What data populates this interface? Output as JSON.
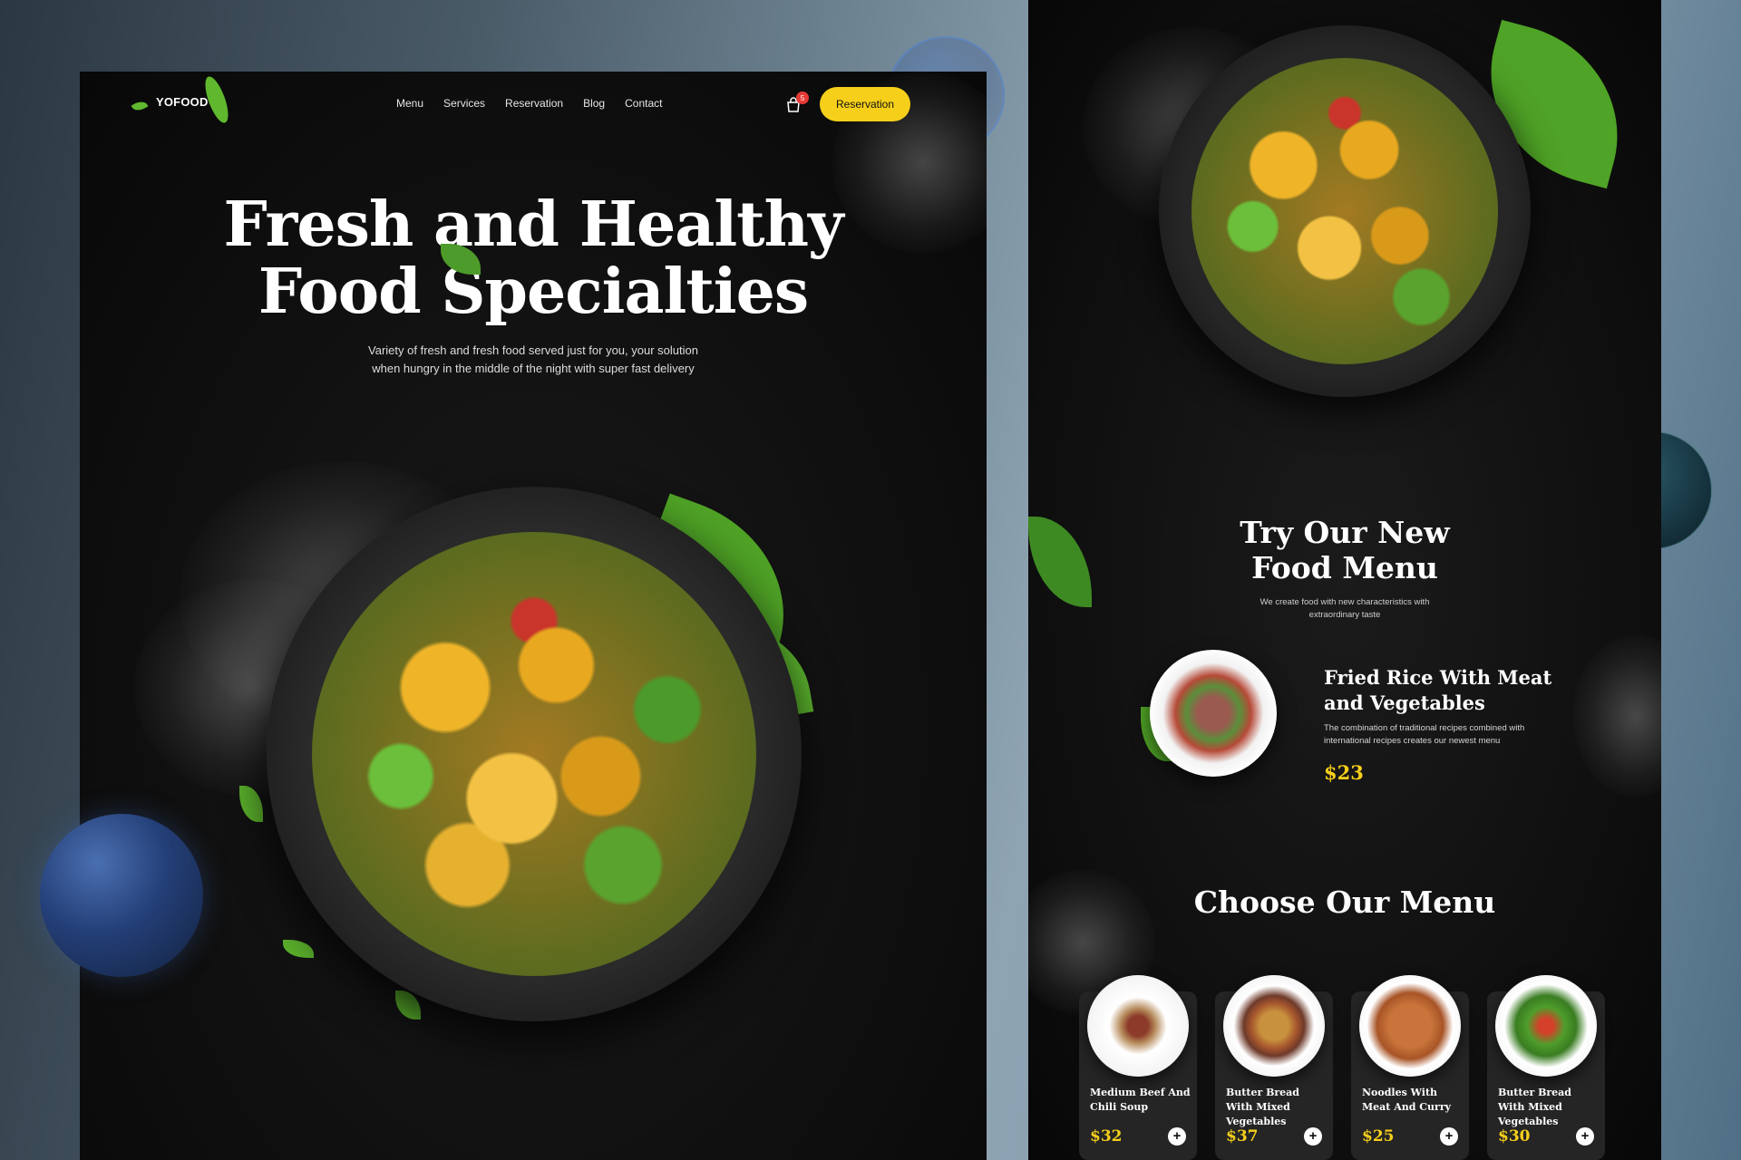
{
  "brand": {
    "logo_text": "YOFOOD"
  },
  "nav": {
    "items": [
      "Menu",
      "Services",
      "Reservation",
      "Blog",
      "Contact"
    ],
    "cart_count": "5",
    "reservation_label": "Reservation"
  },
  "hero": {
    "title_line1": "Fresh and Healthy",
    "title_line2": "Food Specialties",
    "subtitle": "Variety of fresh and fresh food served just for you, your solution when hungry in the middle of the night with super fast delivery"
  },
  "try_section": {
    "title_line1": "Try Our New",
    "title_line2": "Food Menu",
    "subtitle": "We create food with new characteristics with extraordinary taste",
    "featured": {
      "name": "Fried Rice With Meat and Vegetables",
      "description": "The combination of traditional recipes combined with international recipes creates our newest menu",
      "price": "$23"
    }
  },
  "choose_section": {
    "title": "Choose Our Menu",
    "items": [
      {
        "name": "Medium Beef And Chili Soup",
        "price": "$32"
      },
      {
        "name": "Butter Bread With Mixed Vegetables",
        "price": "$37"
      },
      {
        "name": "Noodles With Meat And Curry",
        "price": "$25"
      },
      {
        "name": "Butter Bread With Mixed Vegetables",
        "price": "$30"
      }
    ]
  },
  "colors": {
    "accent": "#f6cf1a",
    "background": "#0f0f0f",
    "badge": "#e53935"
  },
  "icons": [
    "leaf-icon",
    "shopping-bag-icon",
    "plus-icon"
  ]
}
